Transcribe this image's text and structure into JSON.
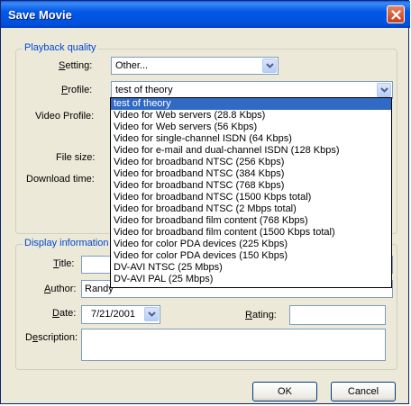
{
  "window": {
    "title": "Save Movie"
  },
  "playback": {
    "group_label": "Playback quality",
    "setting_label": "Setting:",
    "setting_value": "Other...",
    "profile_label": "Profile:",
    "profile_value": "test of theory",
    "video_profile_label": "Video Profile:",
    "file_size_label": "File size:",
    "download_time_label": "Download time:",
    "profile_options": [
      "test of theory",
      "Video for Web servers (28.8 Kbps)",
      "Video for Web servers (56 Kbps)",
      "Video for single-channel ISDN (64 Kbps)",
      "Video for e-mail and dual-channel ISDN (128 Kbps)",
      "Video for broadband NTSC (256 Kbps)",
      "Video for broadband NTSC (384 Kbps)",
      "Video for broadband NTSC (768 Kbps)",
      "Video for broadband NTSC (1500 Kbps total)",
      "Video for broadband NTSC (2 Mbps total)",
      "Video for broadband film content (768 Kbps)",
      "Video for broadband film content (1500 Kbps total)",
      "Video for color PDA devices (225 Kbps)",
      "Video for color PDA devices (150 Kbps)",
      "DV-AVI NTSC (25 Mbps)",
      "DV-AVI PAL (25 Mbps)"
    ],
    "selected_option_index": 0
  },
  "display": {
    "group_label": "Display information",
    "title_label": "Title:",
    "title_value": "",
    "author_label": "Author:",
    "author_value": "Randy",
    "date_label": "Date:",
    "date_value": "7/21/2001",
    "rating_label": "Rating:",
    "rating_value": "",
    "description_label": "Description:",
    "description_value": ""
  },
  "buttons": {
    "ok": "OK",
    "cancel": "Cancel"
  },
  "icons": {
    "close": "close-icon",
    "dropdown": "chevron-down-icon"
  }
}
